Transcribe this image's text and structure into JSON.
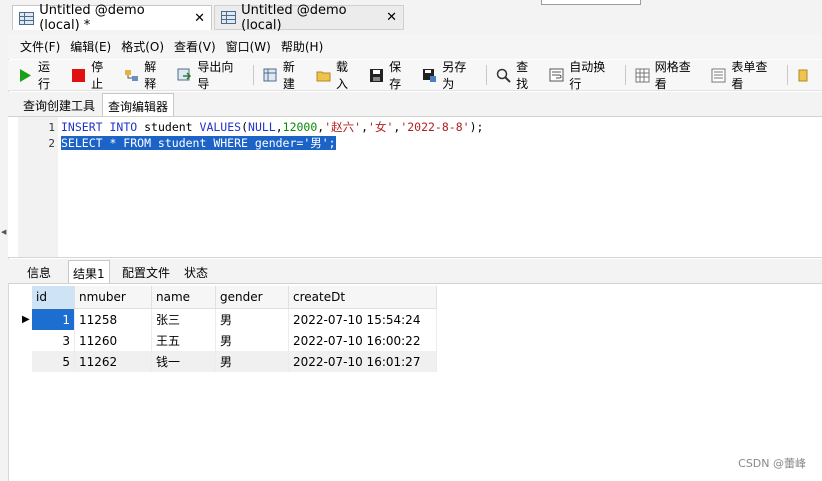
{
  "tabs": [
    {
      "label": "Untitled @demo (local) *",
      "close": "✕",
      "icon": "table-icon",
      "active": true
    },
    {
      "label": "Untitled @demo (local)",
      "close": "✕",
      "icon": "table-icon",
      "active": false
    }
  ],
  "menu": [
    "文件(F)",
    "编辑(E)",
    "格式(O)",
    "查看(V)",
    "窗口(W)",
    "帮助(H)"
  ],
  "toolbar": {
    "run": "运行",
    "stop": "停止",
    "explain": "解释",
    "export": "导出向导",
    "new": "新建",
    "load": "载入",
    "save": "保存",
    "save_as": "另存为",
    "find": "查找",
    "wrap": "自动换行",
    "grid_view": "网格查看",
    "form_view": "表单查看"
  },
  "query_tabs": [
    "查询创建工具",
    "查询编辑器"
  ],
  "editor": {
    "line_numbers": [
      "1",
      "2"
    ],
    "line1": {
      "insert": "INSERT",
      "into": "INTO",
      "table": "student",
      "values": "VALUES",
      "open": "(",
      "null": "NULL",
      "comma1": ",",
      "num": "12000",
      "comma2": ",",
      "s1": "'赵六'",
      "comma3": ",",
      "s2": "'女'",
      "comma4": ",",
      "s3": "'2022-8-8'",
      "close": ");"
    },
    "line2_selected": "SELECT * FROM student WHERE gender='男';"
  },
  "result_tabs": [
    "信息",
    "结果1",
    "配置文件",
    "状态"
  ],
  "grid": {
    "columns": [
      "id",
      "nmuber",
      "name",
      "gender",
      "createDt"
    ],
    "rows": [
      {
        "id": "1",
        "nmuber": "11258",
        "name": "张三",
        "gender": "男",
        "createDt": "2022-07-10 15:54:24"
      },
      {
        "id": "3",
        "nmuber": "11260",
        "name": "王五",
        "gender": "男",
        "createDt": "2022-07-10 16:00:22"
      },
      {
        "id": "5",
        "nmuber": "11262",
        "name": "钱一",
        "gender": "男",
        "createDt": "2022-07-10 16:01:27"
      }
    ],
    "current_row_marker": "▶"
  },
  "watermark": "CSDN @蕾峰",
  "colors": {
    "selection": "#1c63c7",
    "keyword": "#1f35c8",
    "number": "#0a8a0a",
    "string": "#b32020",
    "stop_red": "#e01010",
    "run_green": "#1aa11a"
  }
}
